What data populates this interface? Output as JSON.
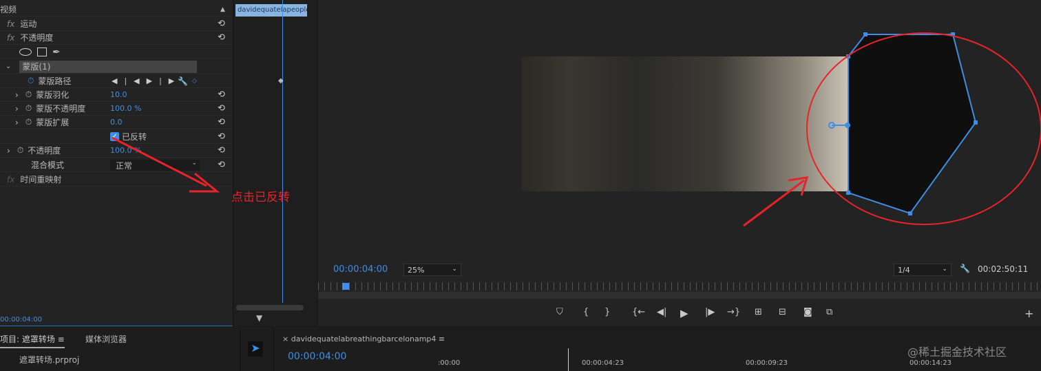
{
  "effects": {
    "section": "视频",
    "motion": "运动",
    "opacity": "不透明度",
    "mask": "蒙版",
    "mask_count": "(1)",
    "mask_path": "蒙版路径",
    "feather": "蒙版羽化",
    "feather_val": "10.0",
    "mask_opacity": "蒙版不透明度",
    "mask_opacity_val": "100.0 %",
    "expansion": "蒙版扩展",
    "expansion_val": "0.0",
    "inverted": "已反转",
    "inverted_checked": true,
    "opacity2": "不透明度",
    "opacity2_val": "100.0 %",
    "blend": "混合模式",
    "blend_val": "正常",
    "remap": "时间重映射",
    "fx": "fx",
    "timecode": "00:00:04:00",
    "clip_name": "davidequatelapeople"
  },
  "annotation": "点击已反转",
  "program": {
    "timecode": "00:00:04:00",
    "zoom": "25%",
    "resolution": "1/4",
    "duration": "00:02:50:11"
  },
  "project": {
    "tab": "项目: 遮罩转场",
    "tab2": "媒体浏览器",
    "file": "遮罩转场.prproj"
  },
  "timeline": {
    "sequence": "davidequatelabreathingbarcelonamp4",
    "timecode": "00:00:04:00",
    "ticks": [
      ":00:00",
      "00:00:04:23",
      "00:00:09:23",
      "00:00:14:23"
    ]
  },
  "watermark": "@稀土掘金技术社区",
  "colors": {
    "accent": "#3e8ee8",
    "annotation": "#e8232a"
  }
}
